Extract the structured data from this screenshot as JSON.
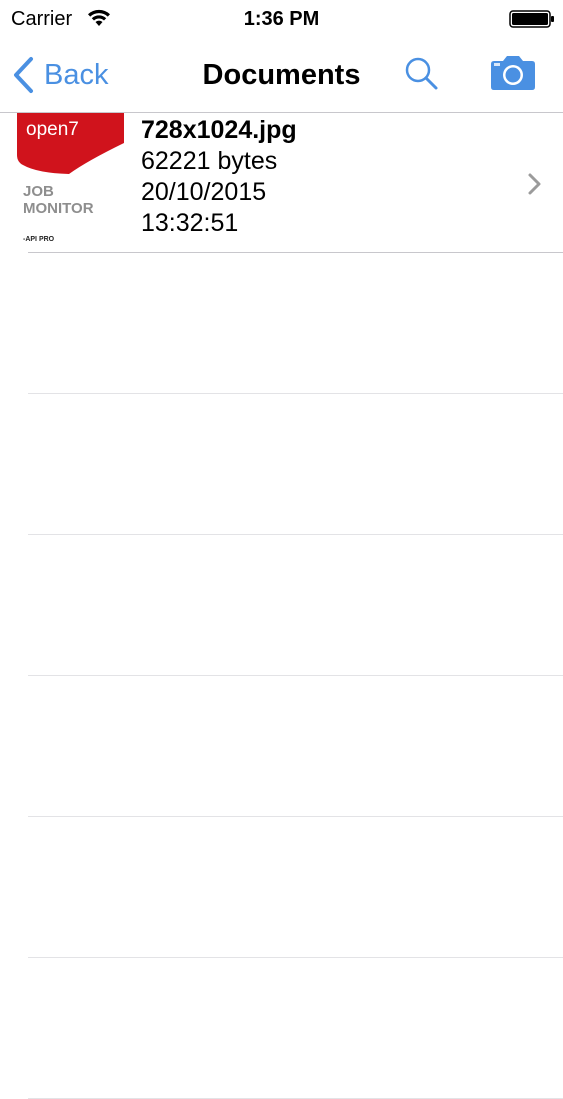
{
  "status_bar": {
    "carrier": "Carrier",
    "time": "1:36 PM",
    "wifi_icon": "wifi-icon",
    "battery_icon": "battery-icon"
  },
  "nav": {
    "back_label": "Back",
    "title": "Documents",
    "search_icon": "search-icon",
    "camera_icon": "camera-icon",
    "accent_color": "#4a90e2"
  },
  "documents": [
    {
      "name": "728x1024.jpg",
      "size": "62221 bytes",
      "date": "20/10/2015",
      "time": "13:32:51",
      "thumbnail": {
        "brand": "open7",
        "line1": "JOB",
        "line2": "MONITOR",
        "caption": "-API PRO",
        "brand_color": "#d0131c"
      }
    }
  ]
}
